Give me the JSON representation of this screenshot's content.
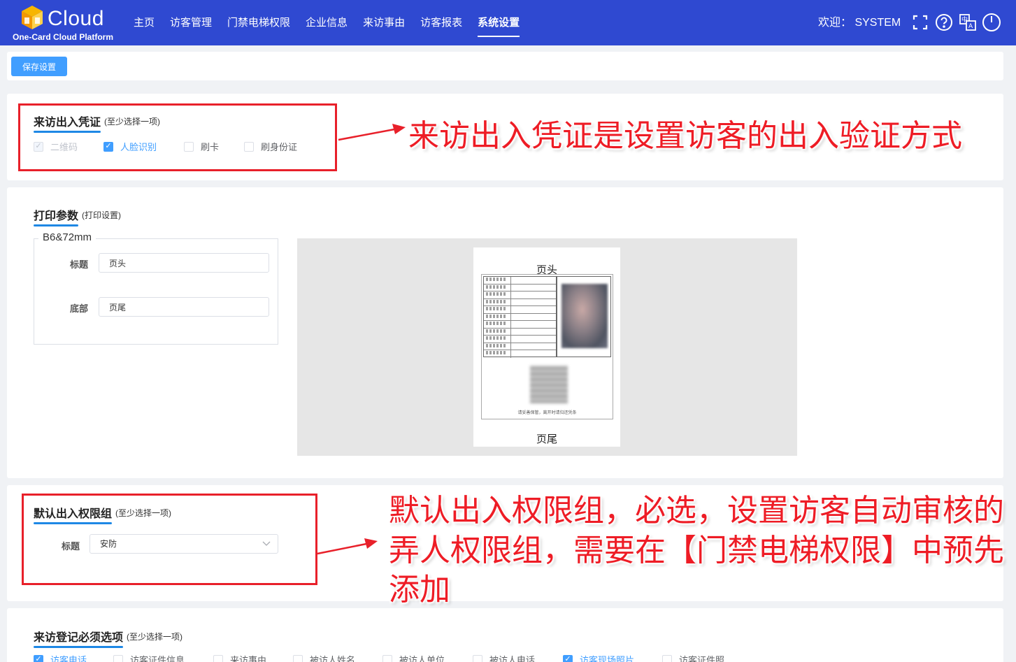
{
  "header": {
    "brand": "Cloud",
    "subtitle": "One-Card Cloud Platform",
    "nav": [
      {
        "label": "主页"
      },
      {
        "label": "访客管理"
      },
      {
        "label": "门禁电梯权限"
      },
      {
        "label": "企业信息"
      },
      {
        "label": "来访事由"
      },
      {
        "label": "访客报表"
      },
      {
        "label": "系统设置",
        "active": true
      }
    ],
    "welcome": "欢迎： SYSTEM",
    "icons": [
      "fullscreen-icon",
      "help-icon",
      "language-icon",
      "power-icon"
    ]
  },
  "toolbar": {
    "save_label": "保存设置"
  },
  "credential": {
    "title": "来访出入凭证",
    "hint": "(至少选择一项)",
    "options": [
      {
        "label": "二维码",
        "checked": true,
        "disabled": true
      },
      {
        "label": "人脸识别",
        "checked": true
      },
      {
        "label": "刷卡",
        "checked": false
      },
      {
        "label": "刷身份证",
        "checked": false
      }
    ]
  },
  "print": {
    "title": "打印参数",
    "hint": "(打印设置)",
    "paper_size": "B6&72mm",
    "title_label": "标题",
    "title_value": "页头",
    "footer_label": "底部",
    "footer_value": "页尾",
    "preview": {
      "header": "页头",
      "footer": "页尾",
      "note": "请妥善保管，离开时请归还凭条"
    }
  },
  "permission": {
    "title": "默认出入权限组",
    "hint": "(至少选择一项)",
    "label": "标题",
    "value": "安防"
  },
  "registration": {
    "title": "来访登记必须选项",
    "hint": "(至少选择一项)",
    "options": [
      {
        "label": "访客电话",
        "checked": true
      },
      {
        "label": "访客证件信息",
        "checked": false
      },
      {
        "label": "来访事由",
        "checked": false
      },
      {
        "label": "被访人姓名",
        "checked": false
      },
      {
        "label": "被访人单位",
        "checked": false
      },
      {
        "label": "被访人电话",
        "checked": false
      },
      {
        "label": "访客现场照片",
        "checked": true
      },
      {
        "label": "访客证件照",
        "checked": false
      }
    ]
  },
  "annotations": {
    "credential": "来访出入凭证是设置访客的出入验证方式",
    "permission_line1": "默认出入权限组，必选，设置访客自动审核的",
    "permission_line2": "弄人权限组，需要在【门禁电梯权限】中预先",
    "permission_line3": "添加"
  },
  "colors": {
    "header_bg": "#2f49d1",
    "accent": "#409eff",
    "annotation": "#ee1c25"
  }
}
